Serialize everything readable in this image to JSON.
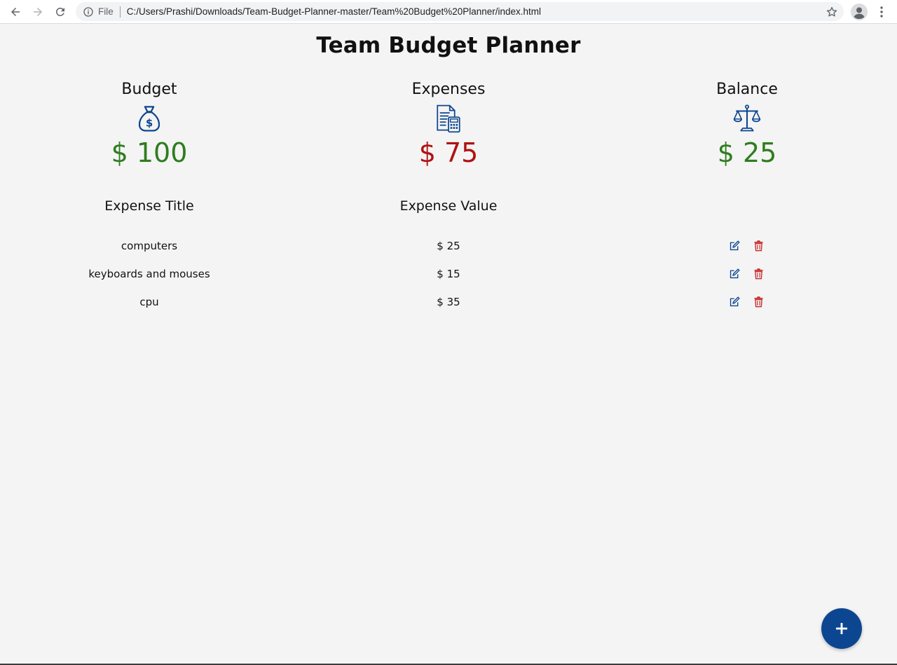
{
  "browser": {
    "scheme_label": "File",
    "url": "C:/Users/Prashi/Downloads/Team-Budget-Planner-master/Team%20Budget%20Planner/index.html"
  },
  "page": {
    "title": "Team Budget Planner"
  },
  "stats": {
    "budget": {
      "label": "Budget",
      "amount": "$ 100",
      "icon": "money-bag-icon",
      "color": "#2e7d1f"
    },
    "expenses": {
      "label": "Expenses",
      "amount": "$ 75",
      "icon": "invoice-calculator-icon",
      "color": "#b01212"
    },
    "balance": {
      "label": "Balance",
      "amount": "$ 25",
      "icon": "scales-icon",
      "color": "#2e7d1f"
    }
  },
  "table": {
    "headers": {
      "title": "Expense Title",
      "value": "Expense Value"
    },
    "rows": [
      {
        "title": "computers",
        "value": "$ 25"
      },
      {
        "title": "keyboards and mouses",
        "value": "$ 15"
      },
      {
        "title": "cpu",
        "value": "$ 35"
      }
    ]
  },
  "fab": {
    "icon": "plus-icon",
    "color": "#0d4690"
  }
}
